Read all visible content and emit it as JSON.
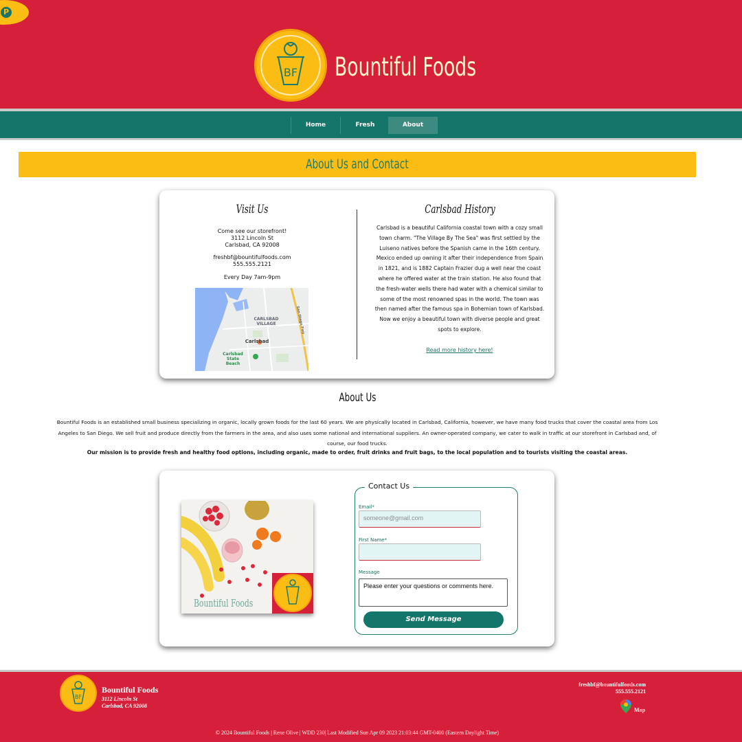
{
  "header": {
    "brand": "Bountiful Foods",
    "logo_text": "BF",
    "icons": [
      "pinterest-icon",
      "strawberry-cup-logo"
    ]
  },
  "nav": {
    "items": [
      {
        "label": "Home"
      },
      {
        "label": "Fresh"
      },
      {
        "label": "About",
        "active": true
      }
    ]
  },
  "banner": {
    "title": "About Us and Contact"
  },
  "visit": {
    "title": "Visit Us",
    "intro": "Come see our storefront!",
    "street": "3112 Lincoln St",
    "city": "Carlsbad, CA 92008",
    "email": "freshbf@bountifulfoods.com",
    "phone": "555.555.2121",
    "hours": "Every Day 7am-9pm",
    "map": {
      "area_label": "CARLSBAD VILLAGE",
      "city_label": "Carlsbad",
      "beach_label": "Carlsbad State Beach",
      "road_label": "San Diego Fwy"
    }
  },
  "history": {
    "title": "Carlsbad History",
    "text": "Carlsbad is a beautiful California coastal town with a cozy small town charm. \"The Village By The Sea\" was first settled by the Luiseno natives before the Spanish came in the 16th century. Mexico ended up owning it after their independence from Spain in 1821, and is 1882 Captain Frazier dug a well near the coast where he offered water at the train station. He also found that the fresh-water wells there had water with a chemical similar to some of the most renowned spas in the world. The town was then named after the famous spa in Bohemian town of Karlsbad. Now we enjoy a beautiful town with diverse people and great spots to explore.",
    "link": "Read more history here!"
  },
  "about": {
    "title": "About Us",
    "text": "Bountiful Foods is an established small business specializing in organic, locally grown foods for the last 60 years. We are physically located in Carlsbad, California, however, we have many food trucks that cover the coastal area from Los Angeles to San Diego. We sell fruit and produce directly from the farmers in the area, and also uses some national and international suppliers. An owner-operated company, we cater to walk in traffic at our storefront in Carlsbad and, of course, our food trucks.",
    "mission": "Our mission is to provide fresh and healthy food options, including organic, made to order, fruit drinks and fruit bags, to the local population and to tourists visiting the coastal areas."
  },
  "contact": {
    "photo_brand": "Bountiful Foods",
    "legend": "Contact Us",
    "email_label": "Email*",
    "email_placeholder": "someone@gmail.com",
    "first_name_label": "First Name*",
    "first_name_value": "",
    "message_label": "Message",
    "message_value": "Please enter your questions or comments here.",
    "send_label": "Send Message"
  },
  "footer": {
    "name": "Bountiful Foods",
    "street": "3112 Lincoln St",
    "city": "Carlsbad, CA 92008",
    "email": "freshbf@bountifulfoods.com",
    "phone": "555.555.2121",
    "map_label": "Map",
    "copyright": "© 2024 Bountiful Foods | Rene Olive | WDD 230| Last Modified Sun Apr 09 2023 21:03:44 GMT-0400 (Eastern Daylight Time)"
  },
  "colors": {
    "brand_red": "#d6203a",
    "brand_teal": "#14756a",
    "brand_yellow": "#fbbc13"
  }
}
